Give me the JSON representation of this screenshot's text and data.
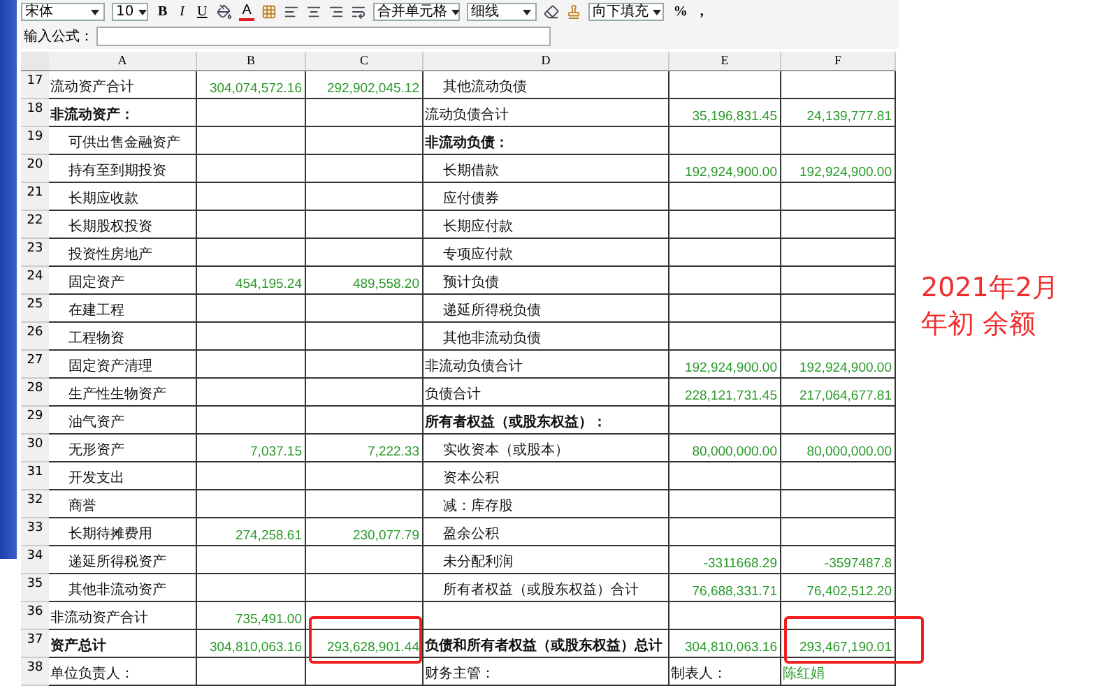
{
  "toolbar": {
    "font": "宋体",
    "size": "10",
    "style_buttons": [
      "B",
      "I",
      "U"
    ],
    "color_button": "A",
    "merge": "合并单元格",
    "border": "细线",
    "fill": "向下填充",
    "format_buttons": [
      "%",
      ","
    ]
  },
  "formula_bar": {
    "label": "输入公式："
  },
  "columns": [
    "A",
    "B",
    "C",
    "D",
    "E",
    "F"
  ],
  "rows": [
    {
      "number": "17",
      "cells": [
        {
          "kind": "label",
          "text": "流动资产合计"
        },
        {
          "kind": "number",
          "text": "304,074,572.16"
        },
        {
          "kind": "number",
          "text": "292,902,045.12"
        },
        {
          "kind": "item",
          "text": "其他流动负债"
        },
        {
          "kind": "empty"
        },
        {
          "kind": "empty"
        }
      ]
    },
    {
      "number": "18",
      "cells": [
        {
          "kind": "heading",
          "text": "非流动资产："
        },
        {
          "kind": "empty"
        },
        {
          "kind": "empty"
        },
        {
          "kind": "label",
          "text": "流动负债合计"
        },
        {
          "kind": "number",
          "text": "35,196,831.45"
        },
        {
          "kind": "number",
          "text": "24,139,777.81"
        }
      ]
    },
    {
      "number": "19",
      "cells": [
        {
          "kind": "item",
          "text": "可供出售金融资产"
        },
        {
          "kind": "empty"
        },
        {
          "kind": "empty"
        },
        {
          "kind": "heading",
          "text": "非流动负债："
        },
        {
          "kind": "empty"
        },
        {
          "kind": "empty"
        }
      ]
    },
    {
      "number": "20",
      "cells": [
        {
          "kind": "item",
          "text": "持有至到期投资"
        },
        {
          "kind": "empty"
        },
        {
          "kind": "empty"
        },
        {
          "kind": "item",
          "text": "长期借款"
        },
        {
          "kind": "number",
          "text": "192,924,900.00"
        },
        {
          "kind": "number",
          "text": "192,924,900.00"
        }
      ]
    },
    {
      "number": "21",
      "cells": [
        {
          "kind": "item",
          "text": "长期应收款"
        },
        {
          "kind": "empty"
        },
        {
          "kind": "empty"
        },
        {
          "kind": "item",
          "text": "应付债券"
        },
        {
          "kind": "empty"
        },
        {
          "kind": "empty"
        }
      ]
    },
    {
      "number": "22",
      "cells": [
        {
          "kind": "item",
          "text": "长期股权投资"
        },
        {
          "kind": "empty"
        },
        {
          "kind": "empty"
        },
        {
          "kind": "item",
          "text": "长期应付款"
        },
        {
          "kind": "empty"
        },
        {
          "kind": "empty"
        }
      ]
    },
    {
      "number": "23",
      "cells": [
        {
          "kind": "item",
          "text": "投资性房地产"
        },
        {
          "kind": "empty"
        },
        {
          "kind": "empty"
        },
        {
          "kind": "item",
          "text": "专项应付款"
        },
        {
          "kind": "empty"
        },
        {
          "kind": "empty"
        }
      ]
    },
    {
      "number": "24",
      "cells": [
        {
          "kind": "item",
          "text": "固定资产"
        },
        {
          "kind": "number",
          "text": "454,195.24"
        },
        {
          "kind": "number",
          "text": "489,558.20"
        },
        {
          "kind": "item",
          "text": "预计负债"
        },
        {
          "kind": "empty"
        },
        {
          "kind": "empty"
        }
      ]
    },
    {
      "number": "25",
      "cells": [
        {
          "kind": "item",
          "text": "在建工程"
        },
        {
          "kind": "empty"
        },
        {
          "kind": "empty"
        },
        {
          "kind": "item",
          "text": "递延所得税负债"
        },
        {
          "kind": "empty"
        },
        {
          "kind": "empty"
        }
      ]
    },
    {
      "number": "26",
      "cells": [
        {
          "kind": "item",
          "text": "工程物资"
        },
        {
          "kind": "empty"
        },
        {
          "kind": "empty"
        },
        {
          "kind": "item",
          "text": "其他非流动负债"
        },
        {
          "kind": "empty"
        },
        {
          "kind": "empty"
        }
      ]
    },
    {
      "number": "27",
      "cells": [
        {
          "kind": "item",
          "text": "固定资产清理"
        },
        {
          "kind": "empty"
        },
        {
          "kind": "empty"
        },
        {
          "kind": "label",
          "text": "非流动负债合计"
        },
        {
          "kind": "number",
          "text": "192,924,900.00"
        },
        {
          "kind": "number",
          "text": "192,924,900.00"
        }
      ]
    },
    {
      "number": "28",
      "cells": [
        {
          "kind": "item",
          "text": "生产性生物资产"
        },
        {
          "kind": "empty"
        },
        {
          "kind": "empty"
        },
        {
          "kind": "label",
          "text": "负债合计"
        },
        {
          "kind": "number",
          "text": "228,121,731.45"
        },
        {
          "kind": "number",
          "text": "217,064,677.81"
        }
      ]
    },
    {
      "number": "29",
      "cells": [
        {
          "kind": "item",
          "text": "油气资产"
        },
        {
          "kind": "empty"
        },
        {
          "kind": "empty"
        },
        {
          "kind": "heading",
          "text": "所有者权益（或股东权益）："
        },
        {
          "kind": "empty"
        },
        {
          "kind": "empty"
        }
      ]
    },
    {
      "number": "30",
      "cells": [
        {
          "kind": "item",
          "text": "无形资产"
        },
        {
          "kind": "number",
          "text": "7,037.15"
        },
        {
          "kind": "number",
          "text": "7,222.33"
        },
        {
          "kind": "item",
          "text": "实收资本（或股本）"
        },
        {
          "kind": "number",
          "text": "80,000,000.00"
        },
        {
          "kind": "number",
          "text": "80,000,000.00"
        }
      ]
    },
    {
      "number": "31",
      "cells": [
        {
          "kind": "item",
          "text": "开发支出"
        },
        {
          "kind": "empty"
        },
        {
          "kind": "empty"
        },
        {
          "kind": "item",
          "text": "资本公积"
        },
        {
          "kind": "empty"
        },
        {
          "kind": "empty"
        }
      ]
    },
    {
      "number": "32",
      "cells": [
        {
          "kind": "item",
          "text": "商誉"
        },
        {
          "kind": "empty"
        },
        {
          "kind": "empty"
        },
        {
          "kind": "item",
          "text": "减：库存股"
        },
        {
          "kind": "empty"
        },
        {
          "kind": "empty"
        }
      ]
    },
    {
      "number": "33",
      "cells": [
        {
          "kind": "item",
          "text": "长期待摊费用"
        },
        {
          "kind": "number",
          "text": "274,258.61"
        },
        {
          "kind": "number",
          "text": "230,077.79"
        },
        {
          "kind": "item",
          "text": "盈余公积"
        },
        {
          "kind": "empty"
        },
        {
          "kind": "empty"
        }
      ]
    },
    {
      "number": "34",
      "cells": [
        {
          "kind": "item",
          "text": "递延所得税资产"
        },
        {
          "kind": "empty"
        },
        {
          "kind": "empty"
        },
        {
          "kind": "item",
          "text": "未分配利润"
        },
        {
          "kind": "number",
          "text": "-3311668.29"
        },
        {
          "kind": "number",
          "text": "-3597487.8"
        }
      ]
    },
    {
      "number": "35",
      "cells": [
        {
          "kind": "item",
          "text": "其他非流动资产"
        },
        {
          "kind": "empty"
        },
        {
          "kind": "empty"
        },
        {
          "kind": "item",
          "text": "所有者权益（或股东权益）合计"
        },
        {
          "kind": "number",
          "text": "76,688,331.71"
        },
        {
          "kind": "number",
          "text": "76,402,512.20"
        }
      ]
    },
    {
      "number": "36",
      "cells": [
        {
          "kind": "label",
          "text": "非流动资产合计"
        },
        {
          "kind": "number",
          "text": "735,491.00"
        },
        {
          "kind": "empty"
        },
        {
          "kind": "empty"
        },
        {
          "kind": "empty"
        },
        {
          "kind": "empty"
        }
      ]
    },
    {
      "number": "37",
      "cells": [
        {
          "kind": "heading",
          "text": "资产总计"
        },
        {
          "kind": "number",
          "text": "304,810,063.16"
        },
        {
          "kind": "number",
          "text": "293,628,901.44",
          "highlighted": true
        },
        {
          "kind": "heading",
          "text": "负债和所有者权益（或股东权益）总计"
        },
        {
          "kind": "number",
          "text": "304,810,063.16"
        },
        {
          "kind": "number",
          "text": "293,467,190.01",
          "highlighted": true
        }
      ]
    },
    {
      "number": "38",
      "cells": [
        {
          "kind": "label",
          "text": "单位负责人："
        },
        {
          "kind": "empty"
        },
        {
          "kind": "empty"
        },
        {
          "kind": "label",
          "text": "财务主管："
        },
        {
          "kind": "label",
          "text": "制表人："
        },
        {
          "kind": "name",
          "text": "陈红娟"
        }
      ]
    }
  ],
  "annotation": [
    "2021年2月",
    "年初 余额"
  ]
}
